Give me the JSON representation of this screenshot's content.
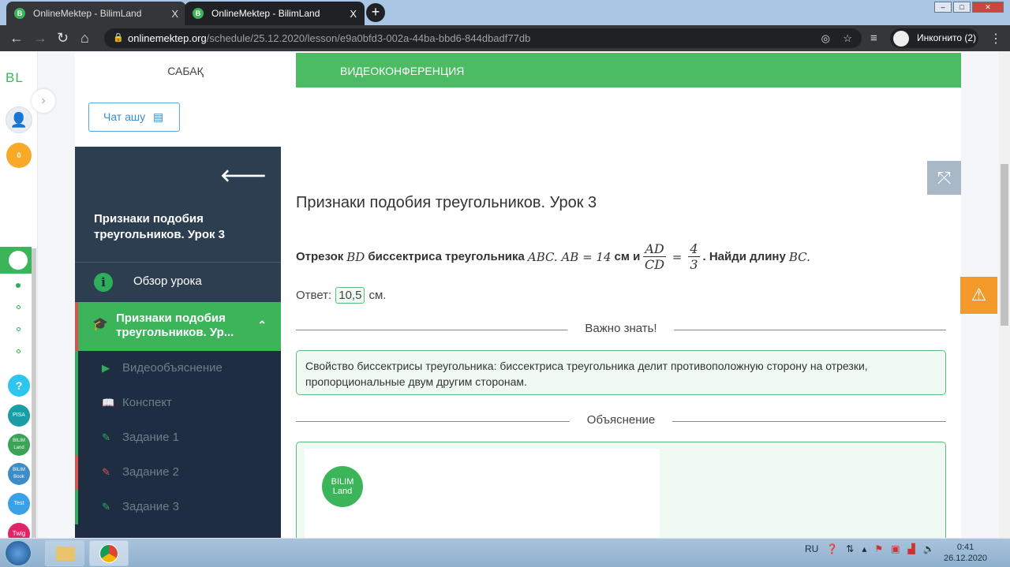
{
  "browser": {
    "tabs": [
      {
        "title": "OnlineMektep - BilimLand",
        "close": "X"
      },
      {
        "title": "OnlineMektep - BilimLand",
        "close": "X"
      }
    ],
    "new_tab": "+",
    "url_domain": "onlinemektep.org",
    "url_path": "/schedule/25.12.2020/lesson/e9a0bfd3-002a-44ba-bbd6-844dbadf77db",
    "incognito": "Инкогнито (2)"
  },
  "rail": {
    "logo": "BL",
    "points": "0",
    "apps": [
      "?",
      "PISA",
      "BILIM Land",
      "BILIM Book",
      "Test",
      "Twig"
    ]
  },
  "header": {
    "lesson_tab": "САБАҚ",
    "video_tab": "ВИДЕОКОНФЕРЕНЦИЯ"
  },
  "chat_button": "Чат ашу",
  "sidebar": {
    "title": "Признаки подобия треугольников. Урок 3",
    "overview": "Обзор урока",
    "section": "Признаки подобия треугольников. Ур...",
    "items": [
      {
        "label": "Видеообъяснение",
        "status": "done"
      },
      {
        "label": "Конспект",
        "status": "done"
      },
      {
        "label": "Задание 1",
        "status": "done"
      },
      {
        "label": "Задание 2",
        "status": "wrong"
      },
      {
        "label": "Задание 3",
        "status": "done"
      }
    ]
  },
  "content": {
    "title": "Признаки подобия треугольников. Урок 3",
    "task": {
      "p1": "Отрезок",
      "m1": "BD",
      "p2": "биссектриса треугольника",
      "m2": "ABC. AB = 14",
      "p3": "см и",
      "num": "AD",
      "den": "CD",
      "eq": "=",
      "n2": "4",
      "d2": "3",
      "p4": ". Найди длину",
      "m3": "BC."
    },
    "answer_label": "Ответ:",
    "answer_value": "10,5",
    "answer_unit": "см.",
    "important": "Важно знать!",
    "note": "Свойство биссектрисы треугольника: биссектриса треугольника делит противоположную сторону на отрезки, пропорциональные двум другим сторонам.",
    "explanation": "Объяснение",
    "logo": "BILIM Land"
  },
  "taskbar": {
    "lang": "RU",
    "time": "0:41",
    "date": "26.12.2020"
  }
}
